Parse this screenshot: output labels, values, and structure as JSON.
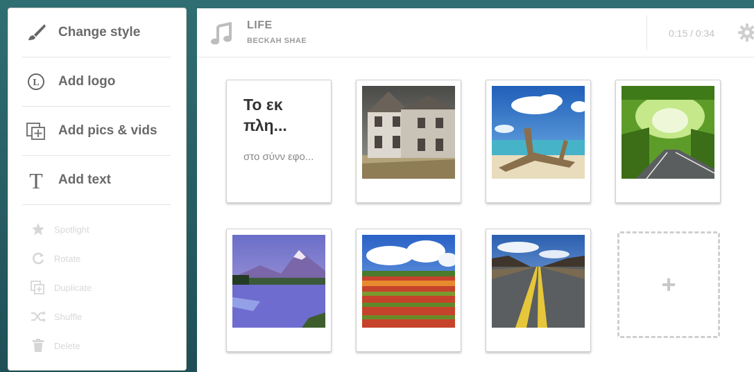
{
  "sidebar": {
    "change_style": "Change style",
    "add_logo": "Add logo",
    "add_pics": "Add pics & vids",
    "add_text": "Add text",
    "actions": [
      "Spotlight",
      "Rotate",
      "Duplicate",
      "Shuffle",
      "Delete"
    ]
  },
  "header": {
    "song_title": "LIFE",
    "artist": "BECKAH SHAE",
    "time": "0:15 / 0:34"
  },
  "text_card": {
    "title": "Το εκ πλη...",
    "subtitle": "στο σύνν εφο..."
  },
  "add_tile": {
    "symbol": "+"
  }
}
